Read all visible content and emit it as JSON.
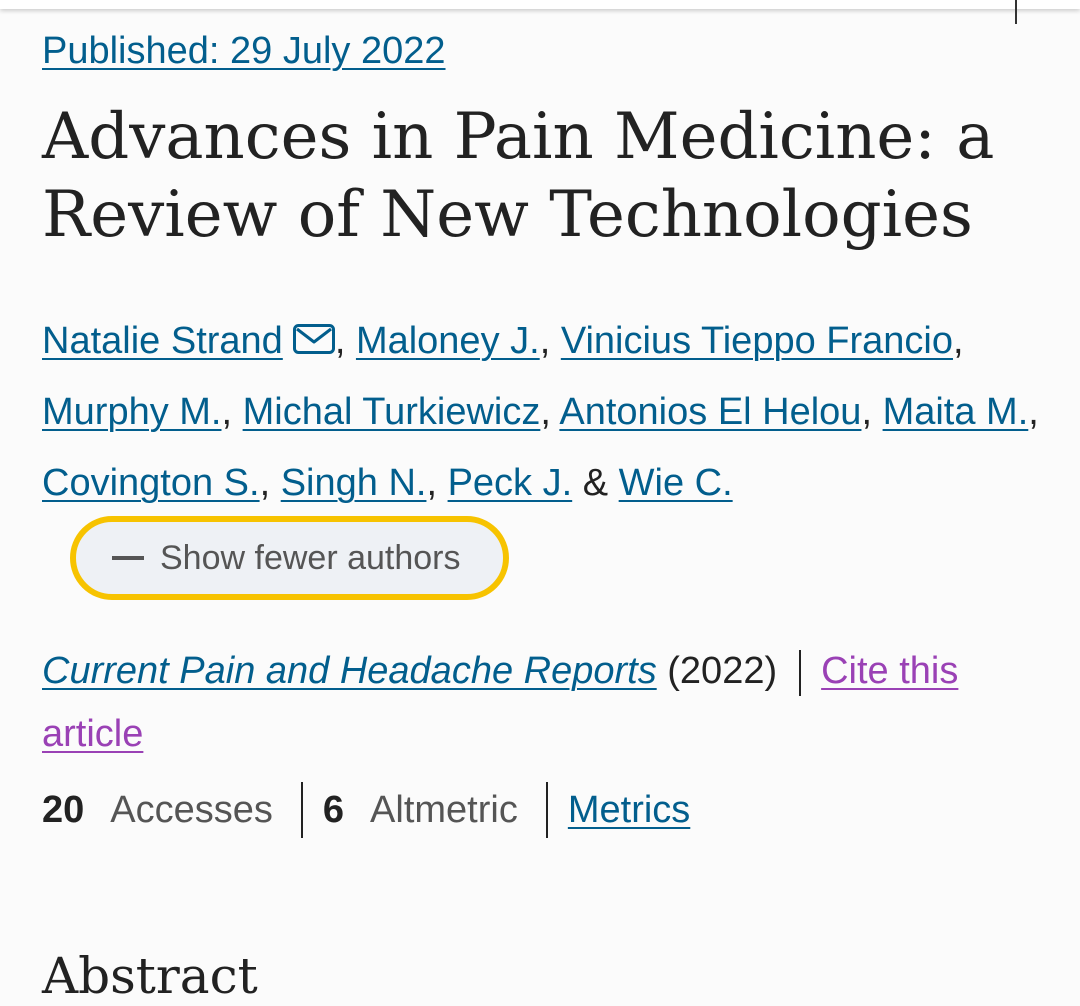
{
  "article": {
    "published_label": "Published: 29 July 2022",
    "title": "Advances in Pain Medicine: a Review of New Technologies",
    "authors": [
      {
        "name": "Natalie Strand",
        "sep": ", "
      },
      {
        "name": "Maloney J.",
        "sep": ", "
      },
      {
        "name": "Vinicius Tieppo Francio",
        "sep": ", "
      },
      {
        "name": "Murphy M.",
        "sep": ", "
      },
      {
        "name": "Michal Turkiewicz",
        "sep": ", "
      },
      {
        "name": "Antonios El Helou",
        "sep": ", "
      },
      {
        "name": "Maita M.",
        "sep": ", "
      },
      {
        "name": "Covington S.",
        "sep": ", "
      },
      {
        "name": "Singh N.",
        "sep": ", "
      },
      {
        "name": "Peck J.",
        "sep": " & "
      },
      {
        "name": "Wie C.",
        "sep": ""
      }
    ],
    "show_fewer_label": "Show fewer authors",
    "journal": "Current Pain and Headache Reports",
    "year": "(2022)",
    "cite_label": "Cite this article",
    "metrics": {
      "accesses_count": "20",
      "accesses_label": "Accesses",
      "altmetric_count": "6",
      "altmetric_label": "Altmetric",
      "metrics_link": "Metrics"
    },
    "abstract_heading": "Abstract"
  },
  "colors": {
    "link": "#025e8d",
    "visited_link": "#9a41b5",
    "focus_ring": "#f7c300",
    "text": "#222222"
  },
  "icons": [
    "mail-icon",
    "minus-icon"
  ]
}
